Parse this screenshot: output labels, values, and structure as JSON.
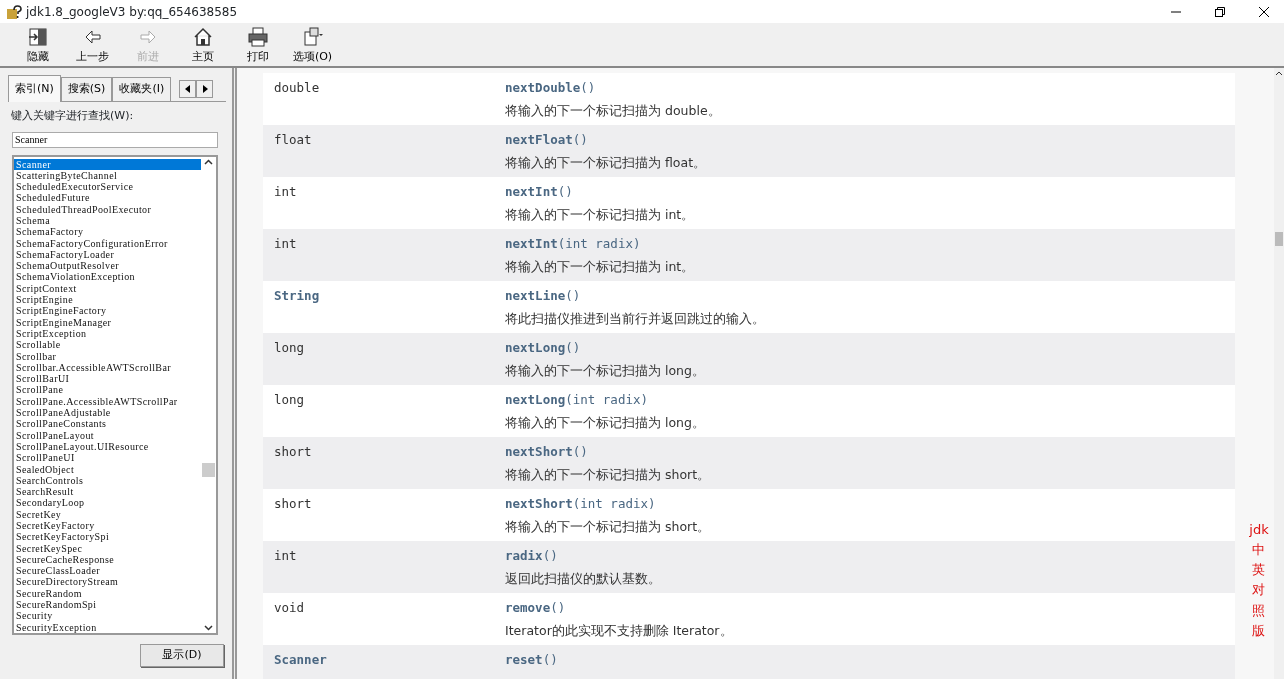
{
  "window": {
    "title": "jdk1.8_googleV3 by:qq_654638585"
  },
  "toolbar": [
    {
      "label": "隐藏",
      "kind": "hide",
      "disabled": false
    },
    {
      "label": "上一步",
      "kind": "back",
      "disabled": false
    },
    {
      "label": "前进",
      "kind": "forward",
      "disabled": true
    },
    {
      "label": "主页",
      "kind": "home",
      "disabled": false
    },
    {
      "label": "打印",
      "kind": "print",
      "disabled": false
    },
    {
      "label": "选项(O)",
      "kind": "options",
      "disabled": false
    }
  ],
  "nav_tabs": [
    {
      "label": "索引(N)",
      "selected": true
    },
    {
      "label": "搜索(S)",
      "selected": false
    },
    {
      "label": "收藏夹(I)",
      "selected": false
    }
  ],
  "keyword_label": "键入关键字进行查找(W):",
  "keyword_field": {
    "value": "Scanner"
  },
  "index_items": [
    {
      "label": "Scanner",
      "selected": true
    },
    {
      "label": "ScatteringByteChannel",
      "selected": false
    },
    {
      "label": "ScheduledExecutorService",
      "selected": false
    },
    {
      "label": "ScheduledFuture",
      "selected": false
    },
    {
      "label": "ScheduledThreadPoolExecutor",
      "selected": false
    },
    {
      "label": "Schema",
      "selected": false
    },
    {
      "label": "SchemaFactory",
      "selected": false
    },
    {
      "label": "SchemaFactoryConfigurationError",
      "selected": false
    },
    {
      "label": "SchemaFactoryLoader",
      "selected": false
    },
    {
      "label": "SchemaOutputResolver",
      "selected": false
    },
    {
      "label": "SchemaViolationException",
      "selected": false
    },
    {
      "label": "ScriptContext",
      "selected": false
    },
    {
      "label": "ScriptEngine",
      "selected": false
    },
    {
      "label": "ScriptEngineFactory",
      "selected": false
    },
    {
      "label": "ScriptEngineManager",
      "selected": false
    },
    {
      "label": "ScriptException",
      "selected": false
    },
    {
      "label": "Scrollable",
      "selected": false
    },
    {
      "label": "Scrollbar",
      "selected": false
    },
    {
      "label": "Scrollbar.AccessibleAWTScrollBar",
      "selected": false
    },
    {
      "label": "ScrollBarUI",
      "selected": false
    },
    {
      "label": "ScrollPane",
      "selected": false
    },
    {
      "label": "ScrollPane.AccessibleAWTScrollPar",
      "selected": false
    },
    {
      "label": "ScrollPaneAdjustable",
      "selected": false
    },
    {
      "label": "ScrollPaneConstants",
      "selected": false
    },
    {
      "label": "ScrollPaneLayout",
      "selected": false
    },
    {
      "label": "ScrollPaneLayout.UIResource",
      "selected": false
    },
    {
      "label": "ScrollPaneUI",
      "selected": false
    },
    {
      "label": "SealedObject",
      "selected": false
    },
    {
      "label": "SearchControls",
      "selected": false
    },
    {
      "label": "SearchResult",
      "selected": false
    },
    {
      "label": "SecondaryLoop",
      "selected": false
    },
    {
      "label": "SecretKey",
      "selected": false
    },
    {
      "label": "SecretKeyFactory",
      "selected": false
    },
    {
      "label": "SecretKeyFactorySpi",
      "selected": false
    },
    {
      "label": "SecretKeySpec",
      "selected": false
    },
    {
      "label": "SecureCacheResponse",
      "selected": false
    },
    {
      "label": "SecureClassLoader",
      "selected": false
    },
    {
      "label": "SecureDirectoryStream",
      "selected": false
    },
    {
      "label": "SecureRandom",
      "selected": false
    },
    {
      "label": "SecureRandomSpi",
      "selected": false
    },
    {
      "label": "Security",
      "selected": false
    },
    {
      "label": "SecurityException",
      "selected": false
    }
  ],
  "display_button": "显示(D)",
  "methods": [
    {
      "type": "double",
      "type_is_link": false,
      "name": "nextDouble",
      "params": "()",
      "description": "将输入的下一个标记扫描为 double。"
    },
    {
      "type": "float",
      "type_is_link": false,
      "name": "nextFloat",
      "params": "()",
      "description": "将输入的下一个标记扫描为 float。"
    },
    {
      "type": "int",
      "type_is_link": false,
      "name": "nextInt",
      "params": "()",
      "description": "将输入的下一个标记扫描为 int。"
    },
    {
      "type": "int",
      "type_is_link": false,
      "name": "nextInt",
      "params": "(int radix)",
      "description": "将输入的下一个标记扫描为 int。"
    },
    {
      "type": "String",
      "type_is_link": true,
      "name": "nextLine",
      "params": "()",
      "description": "将此扫描仪推进到当前行并返回跳过的输入。"
    },
    {
      "type": "long",
      "type_is_link": false,
      "name": "nextLong",
      "params": "()",
      "description": "将输入的下一个标记扫描为 long。"
    },
    {
      "type": "long",
      "type_is_link": false,
      "name": "nextLong",
      "params": "(int radix)",
      "description": "将输入的下一个标记扫描为 long。"
    },
    {
      "type": "short",
      "type_is_link": false,
      "name": "nextShort",
      "params": "()",
      "description": "将输入的下一个标记扫描为 short。"
    },
    {
      "type": "short",
      "type_is_link": false,
      "name": "nextShort",
      "params": "(int radix)",
      "description": "将输入的下一个标记扫描为 short。"
    },
    {
      "type": "int",
      "type_is_link": false,
      "name": "radix",
      "params": "()",
      "description": "返回此扫描仪的默认基数。"
    },
    {
      "type": "void",
      "type_is_link": false,
      "name": "remove",
      "params": "()",
      "description": "Iterator的此实现不支持删除 Iterator。"
    },
    {
      "type": "Scanner",
      "type_is_link": true,
      "name": "reset",
      "params": "()"
    }
  ],
  "side_note": "jdk中英对照版"
}
